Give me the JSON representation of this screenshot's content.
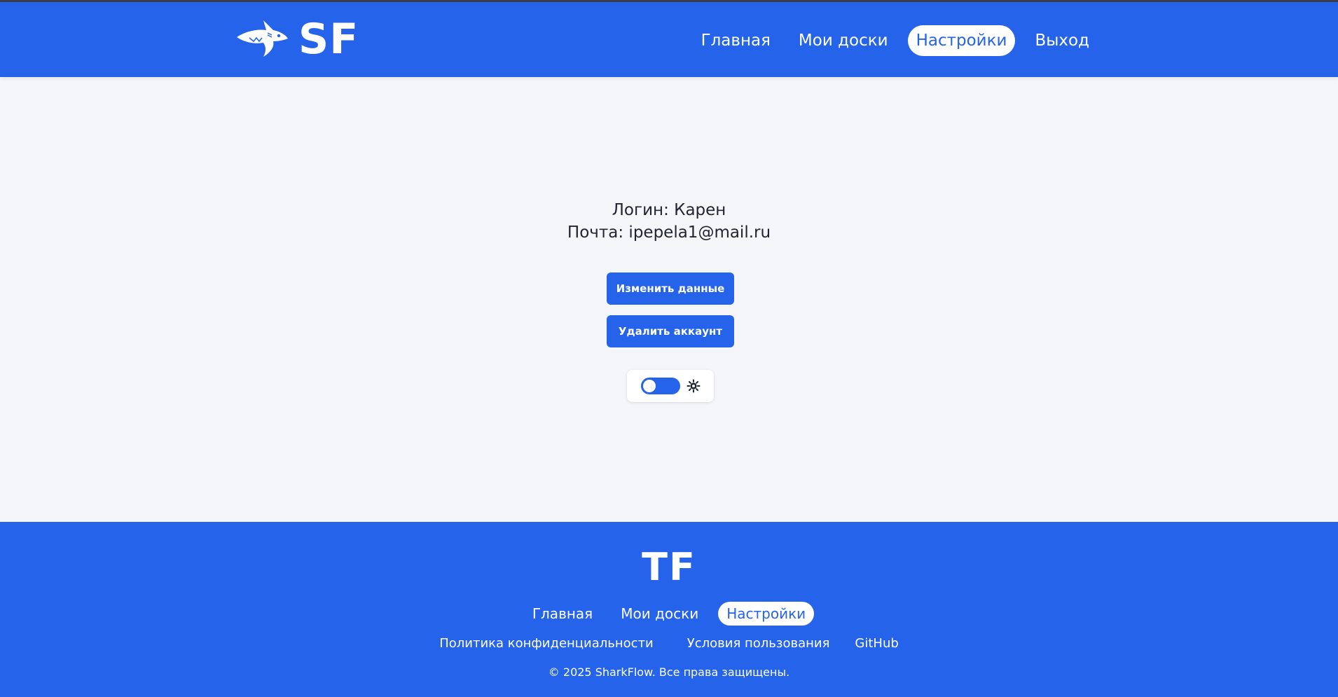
{
  "header": {
    "logo_text": "SF",
    "nav": [
      {
        "label": "Главная",
        "active": false
      },
      {
        "label": "Мои доски",
        "active": false
      },
      {
        "label": "Настройки",
        "active": true
      },
      {
        "label": "Выход",
        "active": false
      }
    ]
  },
  "profile": {
    "login_line": "Логин: Карен",
    "email_line": "Почта: ipepela1@mail.ru"
  },
  "actions": {
    "edit_label": "Изменить данные",
    "delete_label": "Удалить аккаунт"
  },
  "theme_toggle": {
    "icon": "sun-icon",
    "state": "light"
  },
  "footer": {
    "logo_text": "TF",
    "nav": [
      {
        "label": "Главная",
        "active": false
      },
      {
        "label": "Мои доски",
        "active": false
      },
      {
        "label": "Настройки",
        "active": true
      }
    ],
    "links": [
      {
        "label": "Политика конфиденциальности"
      },
      {
        "label": "Условия пользования"
      },
      {
        "label": "GitHub"
      }
    ],
    "copyright": "© 2025 SharkFlow. Все права защищены."
  },
  "colors": {
    "primary": "#2563eb",
    "background": "#f4f6fa",
    "text": "#1f2430"
  }
}
